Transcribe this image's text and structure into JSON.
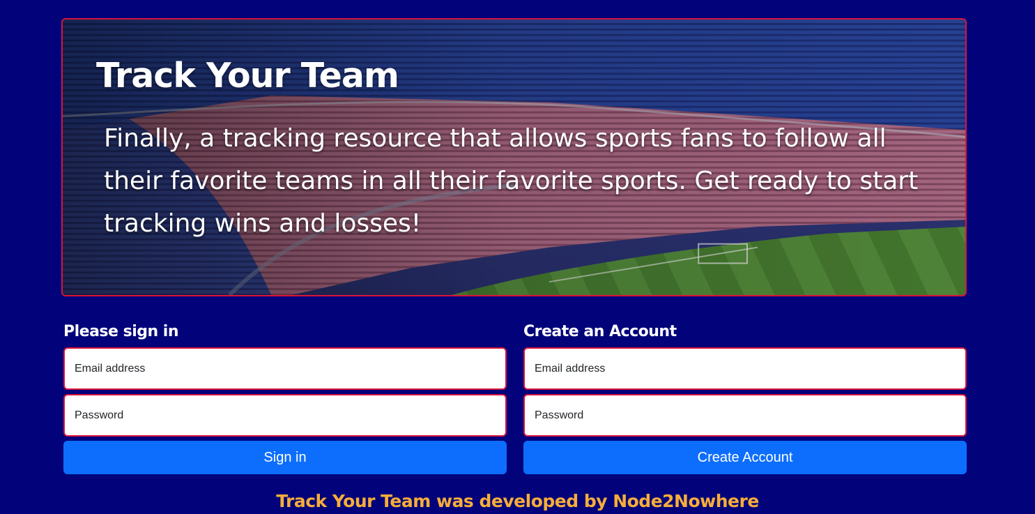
{
  "hero": {
    "title": "Track Your Team",
    "description": "Finally, a tracking resource that allows sports fans to follow all their favorite teams in all their favorite sports. Get ready to start tracking wins and losses!",
    "image": "stadium-photo"
  },
  "signin": {
    "heading": "Please sign in",
    "email_placeholder": "Email address",
    "password_placeholder": "Password",
    "button_label": "Sign in"
  },
  "signup": {
    "heading": "Create an Account",
    "email_placeholder": "Email address",
    "password_placeholder": "Password",
    "button_label": "Create Account"
  },
  "footer": {
    "text": "Track Your Team was developed by Node2Nowhere"
  },
  "colors": {
    "background": "#02037a",
    "accent_border": "#d8143a",
    "button": "#0d6efd",
    "footer_text": "#f6ad3a"
  }
}
